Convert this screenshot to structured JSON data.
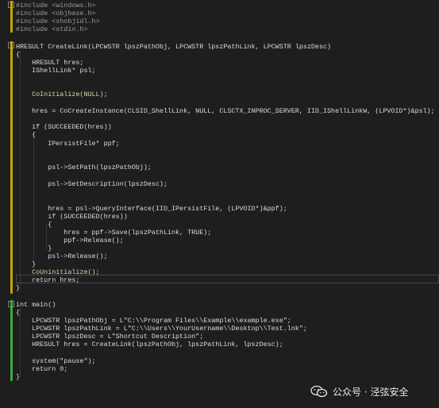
{
  "code": {
    "lines": [
      "#include <windows.h>",
      "#include <objbase.h>",
      "#include <shobjidl.h>",
      "#include <stdio.h>",
      "",
      "HRESULT CreateLink(LPCWSTR lpszPathObj, LPCWSTR lpszPathLink, LPCWSTR lpszDesc)",
      "{",
      "    HRESULT hres;",
      "    IShellLink* psl;",
      "",
      "",
      "    CoInitialize(NULL);",
      "",
      "    hres = CoCreateInstance(CLSID_ShellLink, NULL, CLSCTX_INPROC_SERVER, IID_IShellLinkW, (LPVOID*)&psl);",
      "",
      "    if (SUCCEEDED(hres))",
      "    {",
      "        IPersistFile* ppf;",
      "",
      "",
      "        psl->SetPath(lpszPathObj);",
      "",
      "        psl->SetDescription(lpszDesc);",
      "",
      "",
      "        hres = psl->QueryInterface(IID_IPersistFile, (LPVOID*)&ppf);",
      "        if (SUCCEEDED(hres))",
      "        {",
      "            hres = ppf->Save(lpszPathLink, TRUE);",
      "            ppf->Release();",
      "        }",
      "        psl->Release();",
      "    }",
      "    CoUninitialize();",
      "    return hres;",
      "}",
      "",
      "int main()",
      "{",
      "    LPCWSTR lpszPathObj = L\"C:\\\\Program Files\\\\Example\\\\example.exe\";",
      "    LPCWSTR lpszPathLink = L\"C:\\\\Users\\\\YourUsername\\\\Desktop\\\\Test.lnk\";",
      "    LPCWSTR lpszDesc = L\"Shortcut Description\";",
      "    HRESULT hres = CreateLink(lpszPathObj, lpszPathLink, lpszDesc);",
      "",
      "    system(\"pause\");",
      "    return 0;",
      "}"
    ]
  },
  "watermark": {
    "text": "公众号 · 泾弦安全"
  }
}
